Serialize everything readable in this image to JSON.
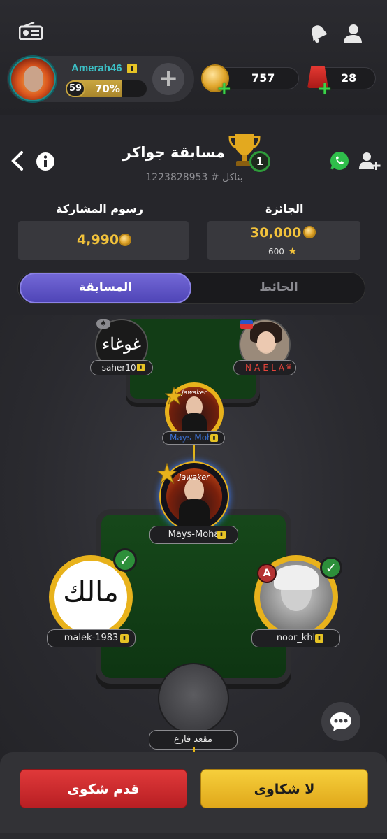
{
  "header": {
    "username": "Amerah46",
    "level": "59",
    "level_progress_label": "70%",
    "level_progress": 0.7,
    "coins": "757",
    "fez": "28"
  },
  "tournament": {
    "title": "مسابقة جواكر",
    "round": "1",
    "id_line": "بناكل # 1223828953",
    "prize_label": "الجائزة",
    "prize_value": "30,000",
    "prize_stars": "600",
    "fee_label": "رسوم المشاركة",
    "fee_value": "4,990"
  },
  "tabs": {
    "competition": "المسابقة",
    "wall": "الحائط",
    "active": "competition"
  },
  "players": {
    "top_left": "saher101",
    "top_right": "N-A-E-L-A",
    "mid_small": "Mays-Moha",
    "mid_large": "Mays-Moha",
    "left": "malek-1983",
    "right": "noor_khl",
    "empty_seat": "مقعد فارغ"
  },
  "avatars": {
    "saher_art": "ﻏﻮﻏﺎﺀ",
    "malek_art": "مالك",
    "mays_art": "Jawaker"
  },
  "actions": {
    "complain": "قدم شكوى",
    "no_complaints": "لا شكاوى"
  },
  "colors": {
    "accent_purple": "#5a50c4",
    "gold": "#e8b21c",
    "red_button": "#cf2b2e",
    "yellow_button": "#f3c22a",
    "username_teal": "#3cc0c6"
  }
}
